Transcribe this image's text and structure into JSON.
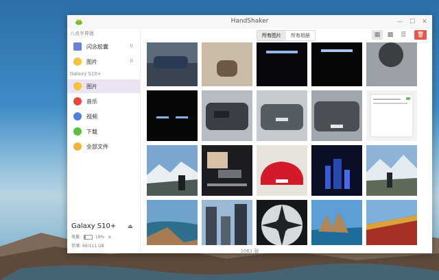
{
  "window": {
    "title": "HandShaker"
  },
  "sidebar": {
    "top_label": "八点半界面",
    "local_items": [
      {
        "label": "闪念胶囊",
        "count": "0",
        "icon": "capsule-icon",
        "color": "#6a7fd6"
      },
      {
        "label": "图片",
        "count": "0",
        "icon": "photo-icon",
        "color": "#f3c43b"
      }
    ],
    "device_label": "Galaxy S10+",
    "device_items": [
      {
        "label": "图片",
        "icon": "photo-icon",
        "color": "#f3c43b",
        "active": true
      },
      {
        "label": "音乐",
        "icon": "music-icon",
        "color": "#e5483d"
      },
      {
        "label": "视频",
        "icon": "video-icon",
        "color": "#4d7fe0"
      },
      {
        "label": "下载",
        "icon": "download-icon",
        "color": "#5cbf3d"
      },
      {
        "label": "全部文件",
        "icon": "folder-icon",
        "color": "#f0b43a"
      }
    ]
  },
  "device": {
    "name": "Galaxy S10+",
    "battery_label": "电量:",
    "battery_pct": "18%",
    "battery_fraction": 0.18,
    "storage_label": "存储:",
    "storage_value": "66/111 GB"
  },
  "toolbar": {
    "tabs": [
      {
        "label": "所有图片",
        "active": true
      },
      {
        "label": "所有相册",
        "active": false
      }
    ],
    "view_buttons": [
      {
        "icon": "large-grid-icon",
        "active": true
      },
      {
        "icon": "small-grid-icon",
        "active": false
      },
      {
        "icon": "list-view-icon",
        "active": false
      }
    ],
    "delete_icon": "trash-icon"
  },
  "status": {
    "count": "1061 张"
  },
  "colors": {
    "accent_active": "#ece3f5",
    "delete": "#e35a4f"
  }
}
